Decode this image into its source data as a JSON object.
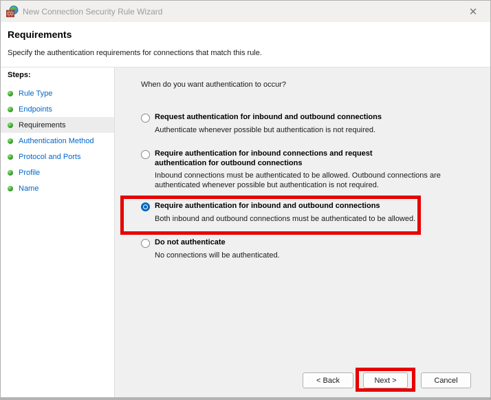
{
  "window": {
    "title": "New Connection Security Rule Wizard",
    "close_glyph": "✕"
  },
  "header": {
    "title": "Requirements",
    "subtitle": "Specify the authentication requirements for connections that match this rule."
  },
  "steps": {
    "label": "Steps:",
    "items": [
      {
        "label": "Rule Type",
        "current": false
      },
      {
        "label": "Endpoints",
        "current": false
      },
      {
        "label": "Requirements",
        "current": true
      },
      {
        "label": "Authentication Method",
        "current": false
      },
      {
        "label": "Protocol and Ports",
        "current": false
      },
      {
        "label": "Profile",
        "current": false
      },
      {
        "label": "Name",
        "current": false
      }
    ]
  },
  "content": {
    "question": "When do you want authentication to occur?",
    "options": [
      {
        "label": "Request authentication for inbound and outbound connections",
        "description": "Authenticate whenever possible but authentication is not required.",
        "selected": false
      },
      {
        "label": "Require authentication for inbound connections and request authentication for outbound connections",
        "description": "Inbound connections must be authenticated to be allowed. Outbound connections are authenticated whenever possible but authentication is not required.",
        "selected": false
      },
      {
        "label": "Require authentication for inbound and outbound connections",
        "description": "Both inbound and outbound connections must be authenticated to be allowed.",
        "selected": true
      },
      {
        "label": "Do not authenticate",
        "description": "No connections will be authenticated.",
        "selected": false
      }
    ]
  },
  "buttons": {
    "back": "< Back",
    "next": "Next >",
    "cancel": "Cancel"
  },
  "colors": {
    "annotation_red": "#e60000",
    "link_blue": "#0066cc",
    "radio_selected_blue": "#0067c0",
    "content_background": "#f0f0f0",
    "step_bullet_green": "#3da52e"
  }
}
